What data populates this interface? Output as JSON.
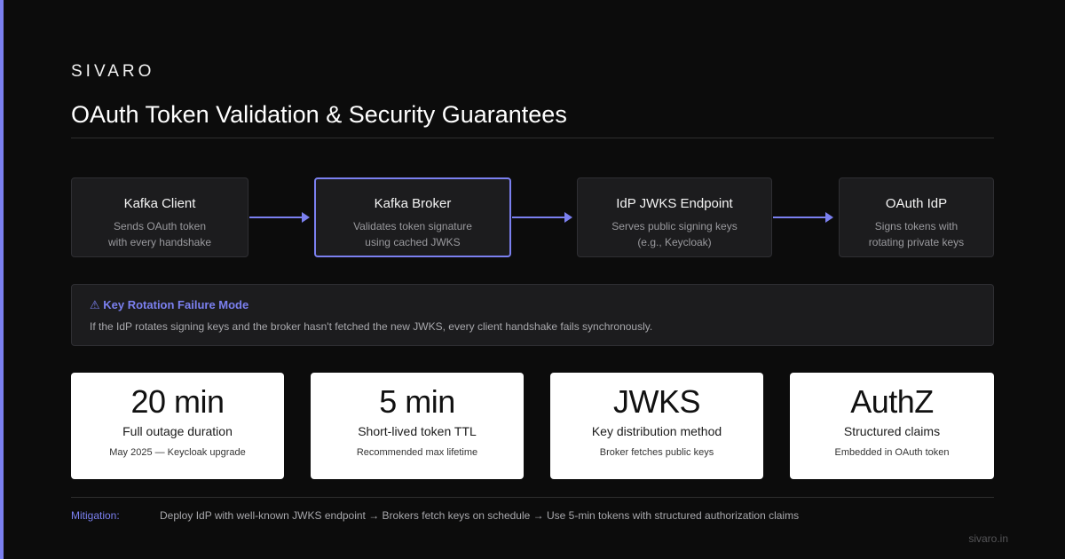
{
  "brand": "SIVARO",
  "title": "OAuth Token Validation & Security Guarantees",
  "accent_color": "#7b80f0",
  "flow": [
    {
      "title": "Kafka Client",
      "desc": [
        "Sends OAuth token",
        "with every handshake"
      ],
      "highlight": false
    },
    {
      "title": "Kafka Broker",
      "desc": [
        "Validates token signature",
        "using cached JWKS"
      ],
      "highlight": true
    },
    {
      "title": "IdP JWKS Endpoint",
      "desc": [
        "Serves public signing keys",
        "(e.g., Keycloak)"
      ],
      "highlight": false
    },
    {
      "title": "OAuth IdP",
      "desc": [
        "Signs tokens with",
        "rotating private keys"
      ],
      "highlight": false
    }
  ],
  "warning": {
    "icon": "warning-icon",
    "title": "⚠ Key Rotation Failure Mode",
    "text": "If the IdP rotates signing keys and the broker hasn't fetched the new JWKS, every client handshake fails synchronously."
  },
  "stats": [
    {
      "value": "20 min",
      "label": "Full outage duration",
      "sub": "May 2025 — Keycloak upgrade"
    },
    {
      "value": "5 min",
      "label": "Short-lived token TTL",
      "sub": "Recommended max lifetime"
    },
    {
      "value": "JWKS",
      "label": "Key distribution method",
      "sub": "Broker fetches public keys"
    },
    {
      "value": "AuthZ",
      "label": "Structured claims",
      "sub": "Embedded in OAuth token"
    }
  ],
  "mitigation": {
    "label": "Mitigation:",
    "text": "Deploy IdP with well-known JWKS endpoint → Brokers fetch keys on schedule → Use 5-min tokens with structured authorization claims"
  },
  "footer": "sivaro.in"
}
